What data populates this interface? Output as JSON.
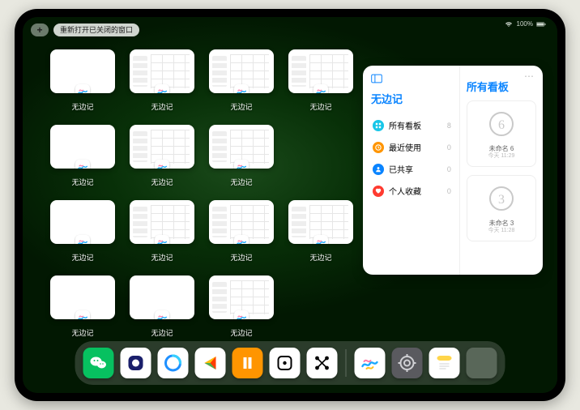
{
  "status": {
    "battery_pct": "100%"
  },
  "topbar": {
    "plus_label": "+",
    "reopen_label": "重新打开已关闭的窗口"
  },
  "thumb_label": "无边记",
  "thumbs": [
    {
      "variant": "plain"
    },
    {
      "variant": "cal"
    },
    {
      "variant": "cal"
    },
    {
      "variant": "cal"
    },
    {
      "variant": "plain"
    },
    {
      "variant": "cal"
    },
    {
      "variant": "cal"
    },
    {
      "variant": "plain"
    },
    {
      "variant": "cal"
    },
    {
      "variant": "cal"
    },
    {
      "variant": "cal"
    },
    {
      "variant": "plain"
    },
    {
      "variant": "plain"
    },
    {
      "variant": "cal"
    }
  ],
  "panel": {
    "left_title": "无边记",
    "right_title": "所有看板",
    "rows": [
      {
        "icon": "grid",
        "color": "#18c6e8",
        "label": "所有看板",
        "count": "8"
      },
      {
        "icon": "clock",
        "color": "#ff9500",
        "label": "最近使用",
        "count": "0"
      },
      {
        "icon": "person",
        "color": "#0a84ff",
        "label": "已共享",
        "count": "0"
      },
      {
        "icon": "heart",
        "color": "#ff3b30",
        "label": "个人收藏",
        "count": "0"
      }
    ],
    "boards": [
      {
        "title": "未命名 6",
        "sub": "今天 11:29",
        "digit": "6"
      },
      {
        "title": "未命名 3",
        "sub": "今天 11:28",
        "digit": "3"
      }
    ]
  },
  "dock": {
    "apps": [
      {
        "name": "wechat-icon",
        "bg": "#07c160"
      },
      {
        "name": "quark-icon",
        "bg": "#fff"
      },
      {
        "name": "qqbrowser-icon",
        "bg": "#fff"
      },
      {
        "name": "play-icon",
        "bg": "#fff"
      },
      {
        "name": "books-icon",
        "bg": "#ff9500"
      },
      {
        "name": "dice-icon",
        "bg": "#fff"
      },
      {
        "name": "graph-icon",
        "bg": "#fff"
      }
    ],
    "after_sep": [
      {
        "name": "freeform-icon",
        "bg": "#fff"
      },
      {
        "name": "settings-icon",
        "bg": "#5a5a5f"
      },
      {
        "name": "notes-icon",
        "bg": "#fff"
      }
    ]
  }
}
